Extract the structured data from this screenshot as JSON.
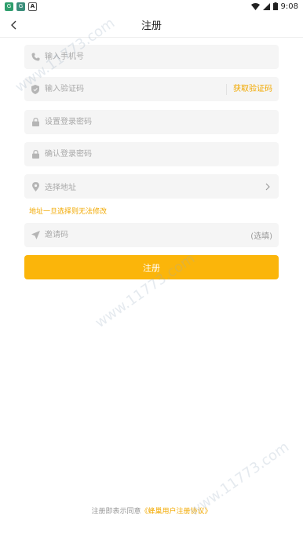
{
  "status_bar": {
    "app_icons": [
      "G",
      "G",
      "A"
    ],
    "time": "9:08"
  },
  "header": {
    "title": "注册"
  },
  "form": {
    "phone_placeholder": "输入手机号",
    "code_placeholder": "输入验证码",
    "get_code_label": "获取验证码",
    "password_placeholder": "设置登录密码",
    "confirm_placeholder": "确认登录密码",
    "address_placeholder": "选择地址",
    "address_warning": "地址一旦选择则无法修改",
    "invite_placeholder": "邀请码",
    "invite_optional": "(选填)",
    "submit_label": "注册"
  },
  "footer": {
    "agreement_prefix": "注册即表示同意",
    "agreement_link": "《蜂巢用户注册协议》"
  },
  "watermark": "www.11773.com",
  "colors": {
    "accent": "#fbb50a",
    "link": "#f2a900",
    "field_bg": "#f5f5f5"
  }
}
